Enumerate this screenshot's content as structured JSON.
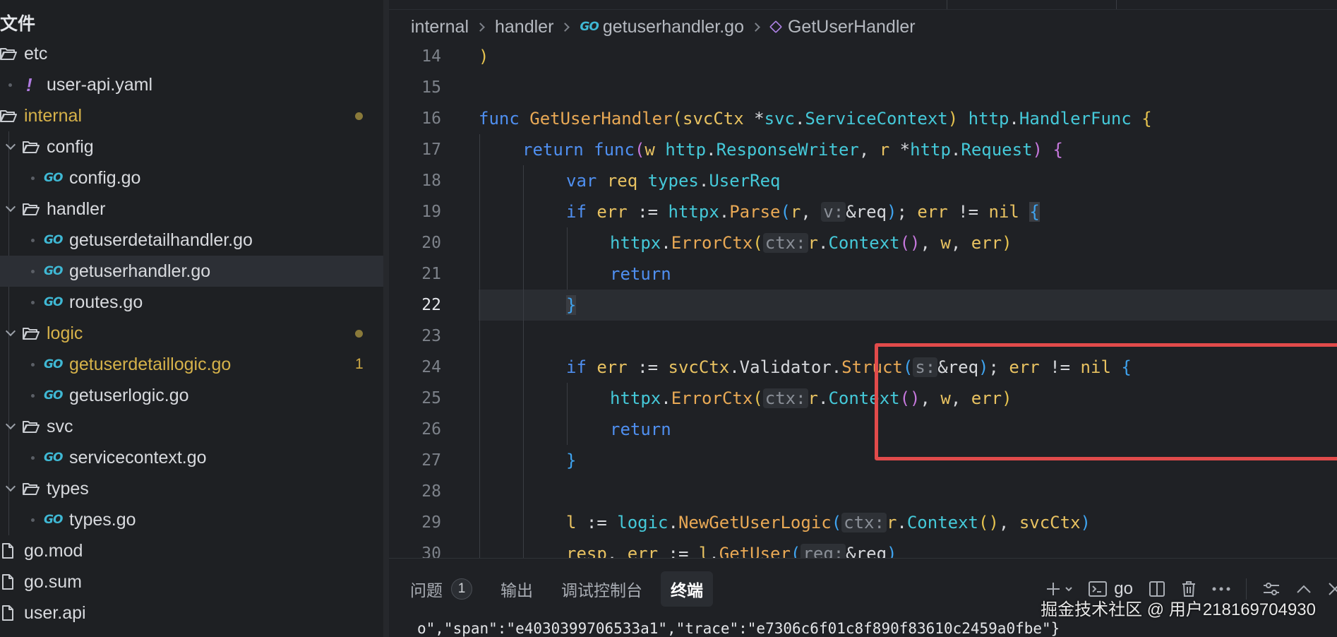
{
  "sidebar": {
    "title": "文件",
    "items": [
      {
        "label": "etc",
        "kind": "folder-open"
      },
      {
        "label": "user-api.yaml",
        "kind": "yaml"
      },
      {
        "label": "internal",
        "kind": "folder-open",
        "modified": true
      },
      {
        "label": "config",
        "kind": "folder-open"
      },
      {
        "label": "config.go",
        "kind": "go"
      },
      {
        "label": "handler",
        "kind": "folder-open"
      },
      {
        "label": "getuserdetailhandler.go",
        "kind": "go"
      },
      {
        "label": "getuserhandler.go",
        "kind": "go",
        "selected": true
      },
      {
        "label": "routes.go",
        "kind": "go"
      },
      {
        "label": "logic",
        "kind": "folder-open",
        "modified": true
      },
      {
        "label": "getuserdetaillogic.go",
        "kind": "go",
        "modified": true,
        "problems": "1"
      },
      {
        "label": "getuserlogic.go",
        "kind": "go"
      },
      {
        "label": "svc",
        "kind": "folder-open"
      },
      {
        "label": "servicecontext.go",
        "kind": "go"
      },
      {
        "label": "types",
        "kind": "folder-open"
      },
      {
        "label": "types.go",
        "kind": "go"
      },
      {
        "label": "go.mod",
        "kind": "file"
      },
      {
        "label": "go.sum",
        "kind": "file"
      },
      {
        "label": "user.api",
        "kind": "file"
      }
    ]
  },
  "breadcrumb": {
    "part1": "internal",
    "part2": "handler",
    "part3": "getuserhandler.go",
    "part4": "GetUserHandler"
  },
  "editor": {
    "active_line": "22",
    "line_numbers": [
      "14",
      "15",
      "16",
      "17",
      "18",
      "19",
      "20",
      "21",
      "22",
      "23",
      "24",
      "25",
      "26",
      "27",
      "28",
      "29",
      "30"
    ],
    "code": {
      "l14": ")",
      "l16_func": "func",
      "l16_name": "GetUserHandler",
      "l16_param": "svcCtx",
      "l16_star": " *",
      "l16_pkg": "svc",
      "l16_type": "ServiceContext",
      "l16_ret_pkg": "http",
      "l16_ret": "HandlerFunc",
      "l17_return": "return",
      "l17_func": "func",
      "l17_w": "w",
      "l17_pkg1": "http",
      "l17_t1": "ResponseWriter",
      "l17_r": "r",
      "l17_pkg2": "http",
      "l17_t2": "Request",
      "l18_var": "var",
      "l18_req": "req",
      "l18_pkg": "types",
      "l18_type": "UserReq",
      "l19_if": "if",
      "l19_err": "err",
      "l19_pkg": "httpx",
      "l19_fn": "Parse",
      "l19_r": "r",
      "l19_hint": "v:",
      "l19_arg": "&req",
      "l19_err2": "err",
      "l19_nil": "nil",
      "l20_pkg": "httpx",
      "l20_fn": "ErrorCtx",
      "l20_hint": "ctx:",
      "l20_r": "r",
      "l20_ctx": "Context",
      "l20_w": "w",
      "l20_err": "err",
      "l21_return": "return",
      "l22_brace": "}",
      "l24_if": "if",
      "l24_err": "err",
      "l24_obj": "svcCtx",
      "l24_field": "Validator",
      "l24_fn": "Struct",
      "l24_hint": "s:",
      "l24_arg": "&req",
      "l24_err2": "err",
      "l24_nil": "nil",
      "l25_pkg": "httpx",
      "l25_fn": "ErrorCtx",
      "l25_hint": "ctx:",
      "l25_r": "r",
      "l25_ctx": "Context",
      "l25_w": "w",
      "l25_err": "err",
      "l26_return": "return",
      "l27_brace": "}",
      "l29_l": "l",
      "l29_pkg": "logic",
      "l29_fn": "NewGetUserLogic",
      "l29_hint": "ctx:",
      "l29_r": "r",
      "l29_ctx": "Context",
      "l29_svc": "svcCtx",
      "l30_resp": "resp",
      "l30_err": "err",
      "l30_l": "l",
      "l30_fn": "GetUser",
      "l30_hint": "req:",
      "l30_arg": "&req"
    }
  },
  "panel": {
    "tabs": [
      {
        "label": "问题",
        "badge": "1"
      },
      {
        "label": "输出"
      },
      {
        "label": "调试控制台"
      },
      {
        "label": "终端",
        "active": true
      }
    ],
    "terminal_profile": "go",
    "terminal_output": "o\",\"span\":\"e4030399706533a1\",\"trace\":\"e7306c6f01c8f890f83610c2459a0fbe\"}",
    "watermark": "掘金技术社区 @ 用户218169704930"
  },
  "colors": {
    "accent_highlight": "#e14b4b",
    "modified": "#d6b24a",
    "go_icon": "#3fb8d4",
    "keyword": "#4f8ff0",
    "function": "#e9a955",
    "type": "#45c9d9"
  }
}
